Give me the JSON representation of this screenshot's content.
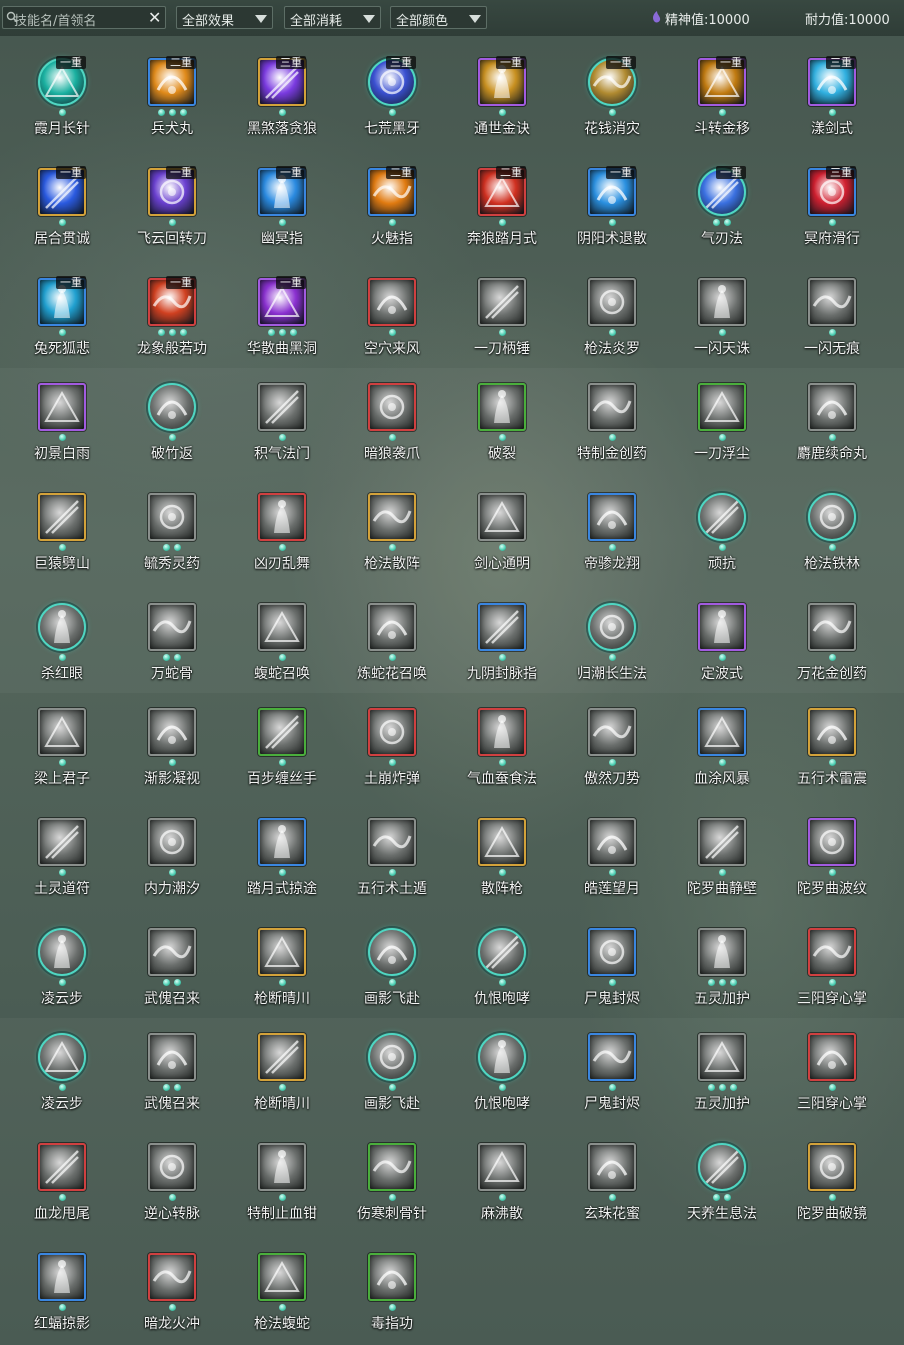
{
  "toolbar": {
    "search_placeholder": "技能名/首领名",
    "filter_effect": "全部效果",
    "filter_cost": "全部消耗",
    "filter_color": "全部颜色",
    "spirit_label": "精神值:",
    "spirit_value": "10000",
    "stamina_label": "耐力值:",
    "stamina_value": "10000"
  },
  "colors": {
    "blue": "#3a86e0",
    "gold": "#d3a23a",
    "purple": "#a25be0",
    "red": "#d04040",
    "green": "#4aae3c",
    "silver": "#8a8f8c",
    "cyan": "#4fd6c2"
  },
  "skills": [
    {
      "name": "霞月长针",
      "rank": "一重",
      "dots": 1,
      "frame": "cyan",
      "style": "color",
      "hue": "#1ab0a0"
    },
    {
      "name": "兵犬丸",
      "rank": "二重",
      "dots": 3,
      "frame": "blue",
      "style": "color",
      "hue": "#e08a1a"
    },
    {
      "name": "黑煞落贪狼",
      "rank": "三重",
      "dots": 1,
      "frame": "gold",
      "style": "color",
      "hue": "#7a3ae0"
    },
    {
      "name": "七荒黑牙",
      "rank": "三重",
      "dots": 1,
      "frame": "cyan",
      "style": "color",
      "hue": "#3a50d0"
    },
    {
      "name": "通世金诀",
      "rank": "一重",
      "dots": 1,
      "frame": "purple",
      "style": "color",
      "hue": "#c89020"
    },
    {
      "name": "花钱消灾",
      "rank": "一重",
      "dots": 1,
      "frame": "cyan",
      "style": "color",
      "hue": "#b08a30"
    },
    {
      "name": "斗转金移",
      "rank": "一重",
      "dots": 1,
      "frame": "purple",
      "style": "color",
      "hue": "#c07a10"
    },
    {
      "name": "漾剑式",
      "rank": "三重",
      "dots": 1,
      "frame": "purple",
      "style": "color",
      "hue": "#30b0e0"
    },
    {
      "name": "居合贯诚",
      "rank": "一重",
      "dots": 1,
      "frame": "gold",
      "style": "color",
      "hue": "#2a5ae0"
    },
    {
      "name": "飞云回转刀",
      "rank": "一重",
      "dots": 1,
      "frame": "gold",
      "style": "color",
      "hue": "#6a40d0"
    },
    {
      "name": "幽冥指",
      "rank": "一重",
      "dots": 1,
      "frame": "blue",
      "style": "color",
      "hue": "#2a8ae0"
    },
    {
      "name": "火魅指",
      "rank": "二重",
      "dots": 1,
      "frame": "blue",
      "style": "color",
      "hue": "#e07a10"
    },
    {
      "name": "奔狼踏月式",
      "rank": "二重",
      "dots": 1,
      "frame": "red",
      "style": "color",
      "hue": "#d03020"
    },
    {
      "name": "阴阳术退散",
      "rank": "一重",
      "dots": 1,
      "frame": "blue",
      "style": "color",
      "hue": "#2a90e0"
    },
    {
      "name": "气刃法",
      "rank": "一重",
      "dots": 2,
      "frame": "cyan",
      "style": "color",
      "hue": "#3a70e0"
    },
    {
      "name": "冥府滑行",
      "rank": "三重",
      "dots": 1,
      "frame": "blue",
      "style": "color",
      "hue": "#d02030"
    },
    {
      "name": "兔死狐悲",
      "rank": "一重",
      "dots": 1,
      "frame": "blue",
      "style": "color",
      "hue": "#20a0d0"
    },
    {
      "name": "龙象般若功",
      "rank": "一重",
      "dots": 3,
      "frame": "red",
      "style": "color",
      "hue": "#d04020"
    },
    {
      "name": "华散曲黑洞",
      "rank": "一重",
      "dots": 3,
      "frame": "purple",
      "style": "color",
      "hue": "#8a30d0"
    },
    {
      "name": "空穴来风",
      "rank": "",
      "dots": 1,
      "frame": "red",
      "style": "grey",
      "hue": "#888"
    },
    {
      "name": "一刀柄锤",
      "rank": "",
      "dots": 1,
      "frame": "silver",
      "style": "grey",
      "hue": "#888"
    },
    {
      "name": "枪法炎罗",
      "rank": "",
      "dots": 1,
      "frame": "silver",
      "style": "grey",
      "hue": "#888"
    },
    {
      "name": "一闪天诛",
      "rank": "",
      "dots": 1,
      "frame": "silver",
      "style": "grey",
      "hue": "#888"
    },
    {
      "name": "一闪无痕",
      "rank": "",
      "dots": 1,
      "frame": "silver",
      "style": "grey",
      "hue": "#888"
    },
    {
      "name": "初景白雨",
      "rank": "",
      "dots": 1,
      "frame": "purple",
      "style": "grey",
      "hue": "#888"
    },
    {
      "name": "破竹返",
      "rank": "",
      "dots": 1,
      "frame": "cyan",
      "style": "grey",
      "hue": "#888"
    },
    {
      "name": "积气法门",
      "rank": "",
      "dots": 1,
      "frame": "silver",
      "style": "grey",
      "hue": "#888"
    },
    {
      "name": "暗狼袭爪",
      "rank": "",
      "dots": 1,
      "frame": "red",
      "style": "grey",
      "hue": "#888"
    },
    {
      "name": "破裂",
      "rank": "",
      "dots": 1,
      "frame": "green",
      "style": "grey",
      "hue": "#888"
    },
    {
      "name": "特制金创药",
      "rank": "",
      "dots": 1,
      "frame": "silver",
      "style": "grey",
      "hue": "#888"
    },
    {
      "name": "一刀浮尘",
      "rank": "",
      "dots": 1,
      "frame": "green",
      "style": "grey",
      "hue": "#888"
    },
    {
      "name": "麝鹿续命丸",
      "rank": "",
      "dots": 1,
      "frame": "silver",
      "style": "grey",
      "hue": "#888"
    },
    {
      "name": "巨猿劈山",
      "rank": "",
      "dots": 1,
      "frame": "gold",
      "style": "grey",
      "hue": "#888"
    },
    {
      "name": "毓秀灵药",
      "rank": "",
      "dots": 2,
      "frame": "silver",
      "style": "grey",
      "hue": "#888"
    },
    {
      "name": "凶刃乱舞",
      "rank": "",
      "dots": 1,
      "frame": "red",
      "style": "grey",
      "hue": "#888"
    },
    {
      "name": "枪法散阵",
      "rank": "",
      "dots": 1,
      "frame": "gold",
      "style": "grey",
      "hue": "#888"
    },
    {
      "name": "剑心通明",
      "rank": "",
      "dots": 1,
      "frame": "silver",
      "style": "grey",
      "hue": "#888"
    },
    {
      "name": "帝骖龙翔",
      "rank": "",
      "dots": 1,
      "frame": "blue",
      "style": "grey",
      "hue": "#888"
    },
    {
      "name": "顽抗",
      "rank": "",
      "dots": 1,
      "frame": "cyan",
      "style": "grey",
      "hue": "#888"
    },
    {
      "name": "枪法铁林",
      "rank": "",
      "dots": 1,
      "frame": "cyan",
      "style": "grey",
      "hue": "#888"
    },
    {
      "name": "杀红眼",
      "rank": "",
      "dots": 1,
      "frame": "cyan",
      "style": "grey",
      "hue": "#888"
    },
    {
      "name": "万蛇骨",
      "rank": "",
      "dots": 2,
      "frame": "silver",
      "style": "grey",
      "hue": "#888"
    },
    {
      "name": "蝮蛇召唤",
      "rank": "",
      "dots": 1,
      "frame": "silver",
      "style": "grey",
      "hue": "#888"
    },
    {
      "name": "炼蛇花召唤",
      "rank": "",
      "dots": 1,
      "frame": "silver",
      "style": "grey",
      "hue": "#888"
    },
    {
      "name": "九阴封脉指",
      "rank": "",
      "dots": 1,
      "frame": "blue",
      "style": "grey",
      "hue": "#888"
    },
    {
      "name": "归潮长生法",
      "rank": "",
      "dots": 1,
      "frame": "cyan",
      "style": "grey",
      "hue": "#888"
    },
    {
      "name": "定波式",
      "rank": "",
      "dots": 1,
      "frame": "purple",
      "style": "grey",
      "hue": "#888"
    },
    {
      "name": "万花金创药",
      "rank": "",
      "dots": 1,
      "frame": "silver",
      "style": "grey",
      "hue": "#888"
    },
    {
      "name": "梁上君子",
      "rank": "",
      "dots": 1,
      "frame": "silver",
      "style": "grey",
      "hue": "#888"
    },
    {
      "name": "渐影凝视",
      "rank": "",
      "dots": 1,
      "frame": "silver",
      "style": "grey",
      "hue": "#888"
    },
    {
      "name": "百步缠丝手",
      "rank": "",
      "dots": 1,
      "frame": "green",
      "style": "grey",
      "hue": "#888"
    },
    {
      "name": "土崩炸弹",
      "rank": "",
      "dots": 1,
      "frame": "red",
      "style": "grey",
      "hue": "#888"
    },
    {
      "name": "气血蚕食法",
      "rank": "",
      "dots": 1,
      "frame": "red",
      "style": "grey",
      "hue": "#888"
    },
    {
      "name": "傲然刀势",
      "rank": "",
      "dots": 1,
      "frame": "silver",
      "style": "grey",
      "hue": "#888"
    },
    {
      "name": "血涂风暴",
      "rank": "",
      "dots": 1,
      "frame": "blue",
      "style": "grey",
      "hue": "#888"
    },
    {
      "name": "五行术雷震",
      "rank": "",
      "dots": 1,
      "frame": "gold",
      "style": "grey",
      "hue": "#888"
    },
    {
      "name": "土灵道符",
      "rank": "",
      "dots": 1,
      "frame": "silver",
      "style": "grey",
      "hue": "#888"
    },
    {
      "name": "内力潮汐",
      "rank": "",
      "dots": 1,
      "frame": "silver",
      "style": "grey",
      "hue": "#888"
    },
    {
      "name": "踏月式掠途",
      "rank": "",
      "dots": 1,
      "frame": "blue",
      "style": "grey",
      "hue": "#888"
    },
    {
      "name": "五行术土遁",
      "rank": "",
      "dots": 1,
      "frame": "silver",
      "style": "grey",
      "hue": "#888"
    },
    {
      "name": "散阵枪",
      "rank": "",
      "dots": 1,
      "frame": "gold",
      "style": "grey",
      "hue": "#888"
    },
    {
      "name": "皓莲望月",
      "rank": "",
      "dots": 1,
      "frame": "silver",
      "style": "grey",
      "hue": "#888"
    },
    {
      "name": "陀罗曲静壁",
      "rank": "",
      "dots": 1,
      "frame": "silver",
      "style": "grey",
      "hue": "#888"
    },
    {
      "name": "陀罗曲波纹",
      "rank": "",
      "dots": 1,
      "frame": "purple",
      "style": "grey",
      "hue": "#888"
    },
    {
      "name": "凌云步",
      "rank": "",
      "dots": 1,
      "frame": "cyan",
      "style": "grey",
      "hue": "#888"
    },
    {
      "name": "武傀召来",
      "rank": "",
      "dots": 2,
      "frame": "silver",
      "style": "grey",
      "hue": "#888"
    },
    {
      "name": "枪断晴川",
      "rank": "",
      "dots": 1,
      "frame": "gold",
      "style": "grey",
      "hue": "#888"
    },
    {
      "name": "画影飞赴",
      "rank": "",
      "dots": 1,
      "frame": "cyan",
      "style": "grey",
      "hue": "#888"
    },
    {
      "name": "仇恨咆哮",
      "rank": "",
      "dots": 1,
      "frame": "cyan",
      "style": "grey",
      "hue": "#888"
    },
    {
      "name": "尸鬼封烬",
      "rank": "",
      "dots": 1,
      "frame": "blue",
      "style": "grey",
      "hue": "#888"
    },
    {
      "name": "五灵加护",
      "rank": "",
      "dots": 3,
      "frame": "silver",
      "style": "grey",
      "hue": "#888"
    },
    {
      "name": "三阳穿心掌",
      "rank": "",
      "dots": 1,
      "frame": "red",
      "style": "grey",
      "hue": "#888"
    },
    {
      "name": "凌云步",
      "rank": "",
      "dots": 1,
      "frame": "cyan",
      "style": "grey",
      "hue": "#888"
    },
    {
      "name": "武傀召来",
      "rank": "",
      "dots": 2,
      "frame": "silver",
      "style": "grey",
      "hue": "#888"
    },
    {
      "name": "枪断晴川",
      "rank": "",
      "dots": 1,
      "frame": "gold",
      "style": "grey",
      "hue": "#888"
    },
    {
      "name": "画影飞赴",
      "rank": "",
      "dots": 1,
      "frame": "cyan",
      "style": "grey",
      "hue": "#888"
    },
    {
      "name": "仇恨咆哮",
      "rank": "",
      "dots": 1,
      "frame": "cyan",
      "style": "grey",
      "hue": "#888"
    },
    {
      "name": "尸鬼封烬",
      "rank": "",
      "dots": 1,
      "frame": "blue",
      "style": "grey",
      "hue": "#888"
    },
    {
      "name": "五灵加护",
      "rank": "",
      "dots": 3,
      "frame": "silver",
      "style": "grey",
      "hue": "#888"
    },
    {
      "name": "三阳穿心掌",
      "rank": "",
      "dots": 1,
      "frame": "red",
      "style": "grey",
      "hue": "#888"
    },
    {
      "name": "血龙甩尾",
      "rank": "",
      "dots": 1,
      "frame": "red",
      "style": "grey",
      "hue": "#888"
    },
    {
      "name": "逆心转脉",
      "rank": "",
      "dots": 1,
      "frame": "silver",
      "style": "grey",
      "hue": "#888"
    },
    {
      "name": "特制止血钳",
      "rank": "",
      "dots": 1,
      "frame": "silver",
      "style": "grey",
      "hue": "#888"
    },
    {
      "name": "伤寒刺骨针",
      "rank": "",
      "dots": 1,
      "frame": "green",
      "style": "grey",
      "hue": "#888"
    },
    {
      "name": "麻沸散",
      "rank": "",
      "dots": 1,
      "frame": "silver",
      "style": "grey",
      "hue": "#888"
    },
    {
      "name": "玄珠花蜜",
      "rank": "",
      "dots": 1,
      "frame": "silver",
      "style": "grey",
      "hue": "#888"
    },
    {
      "name": "天养生息法",
      "rank": "",
      "dots": 2,
      "frame": "cyan",
      "style": "grey",
      "hue": "#888"
    },
    {
      "name": "陀罗曲破镜",
      "rank": "",
      "dots": 1,
      "frame": "gold",
      "style": "grey",
      "hue": "#888"
    },
    {
      "name": "红蝠掠影",
      "rank": "",
      "dots": 1,
      "frame": "blue",
      "style": "grey",
      "hue": "#888"
    },
    {
      "name": "暗龙火冲",
      "rank": "",
      "dots": 1,
      "frame": "red",
      "style": "grey",
      "hue": "#888"
    },
    {
      "name": "枪法蝮蛇",
      "rank": "",
      "dots": 1,
      "frame": "green",
      "style": "grey",
      "hue": "#888"
    },
    {
      "name": "毒指功",
      "rank": "",
      "dots": 1,
      "frame": "green",
      "style": "grey",
      "hue": "#888"
    }
  ]
}
